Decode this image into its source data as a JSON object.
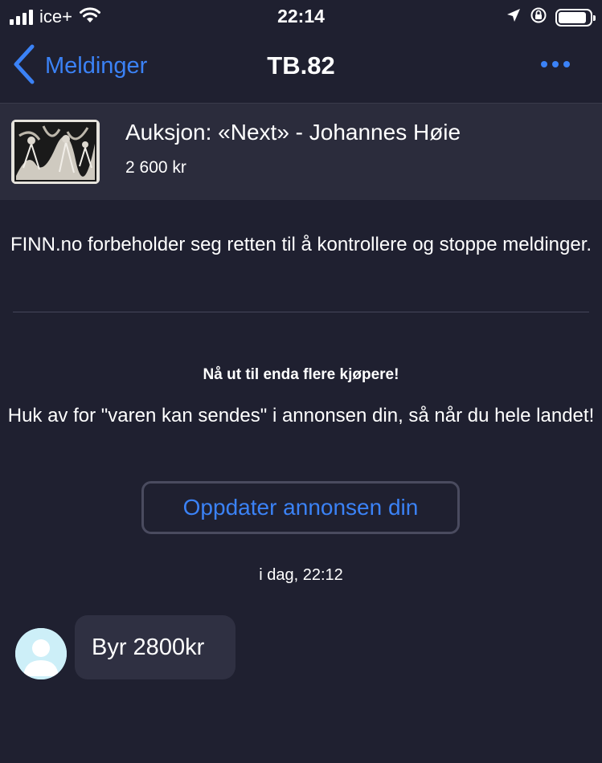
{
  "status_bar": {
    "carrier": "ice+",
    "time": "22:14",
    "icons": [
      "signal-icon",
      "wifi-icon",
      "location-icon",
      "rotation-lock-icon",
      "battery-icon"
    ]
  },
  "nav": {
    "back_label": "Meldinger",
    "title": "TB.82",
    "more_icon": "more-icon"
  },
  "ad": {
    "title": "Auksjon: «Next» - Johannes Høie",
    "price": "2 600 kr"
  },
  "disclaimer": "FINN.no forbeholder seg retten til å kontrollere og stoppe meldinger.",
  "promo": {
    "title": "Nå ut til enda flere kjøpere!",
    "text": "Huk av for \"varen kan sendes\" i annonsen din, så når du hele landet!",
    "button_label": "Oppdater annonsen din"
  },
  "conversation": {
    "timestamp": "i dag, 22:12",
    "messages": [
      {
        "text": "Byr 2800kr"
      }
    ]
  },
  "colors": {
    "background": "#1f2030",
    "header_bg": "#2b2c3c",
    "accent": "#3b82f6",
    "bubble_bg": "#2f3042"
  }
}
